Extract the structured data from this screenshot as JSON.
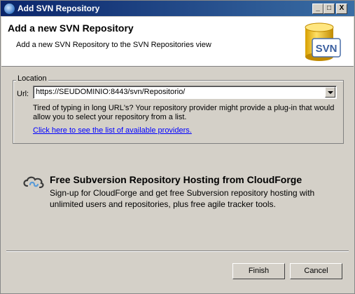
{
  "window": {
    "title": "Add SVN Repository",
    "controls": {
      "minimize": "_",
      "maximize": "□",
      "close": "X"
    }
  },
  "header": {
    "title": "Add a new SVN Repository",
    "description": "Add a new SVN Repository to the SVN Repositories view",
    "logo_text": "SVN",
    "logo_icon": "svn-database-icon"
  },
  "location": {
    "group_label": "Location",
    "url_label": "Url:",
    "url_value": "https://SEUDOMINIO:8443/svn/Repositorio/",
    "hint": "Tired of typing in long URL's?  Your repository provider might provide a plug-in that would allow you to select your repository from a list.",
    "providers_link": "Click here to see the list of available providers."
  },
  "cloudforge": {
    "icon": "cloudforge-icon",
    "title": "Free Subversion Repository Hosting from CloudForge",
    "description": "Sign-up for CloudForge and get free Subversion repository hosting with unlimited users and repositories, plus free agile tracker tools."
  },
  "buttons": {
    "finish": "Finish",
    "cancel": "Cancel"
  },
  "colors": {
    "titlebar": "#0a246a",
    "dialog_bg": "#d4d0c8",
    "link": "#0000ff"
  }
}
